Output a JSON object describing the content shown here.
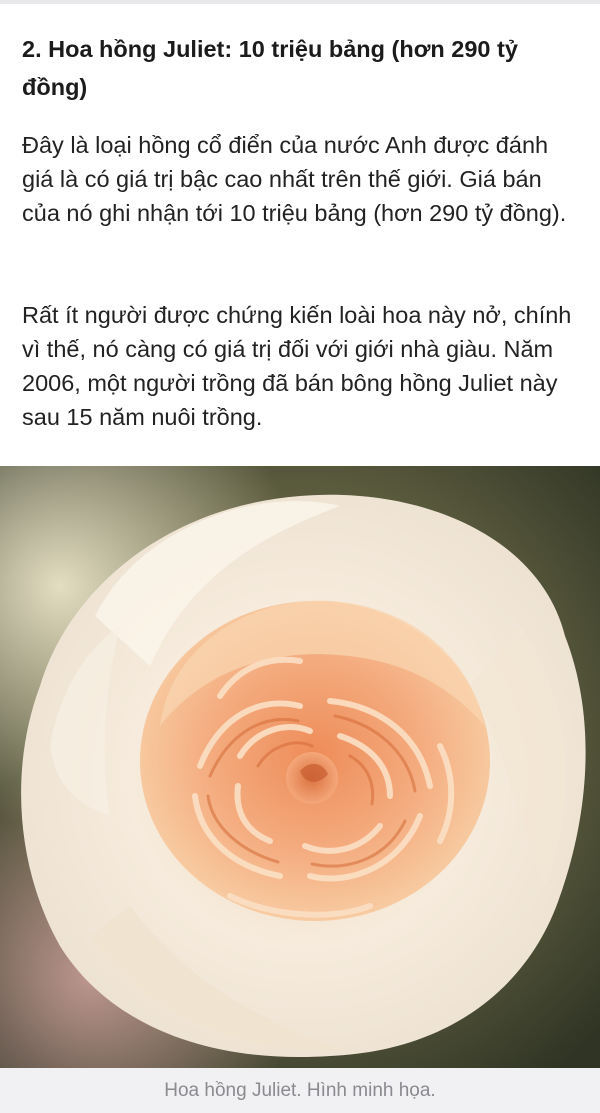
{
  "article": {
    "heading": "2. Hoa hồng Juliet: 10 triệu bảng (hơn 290 tỷ đồng)",
    "paragraphs": [
      "Đây là loại hồng cổ điển của nước Anh được đánh giá là có giá trị bậc cao nhất trên thế giới. Giá bán của nó ghi nhận tới 10 triệu bảng (hơn 290 tỷ đồng).",
      "Rất ít người được chứng kiến loài hoa này nở, chính vì thế, nó càng có giá trị đối với giới nhà giàu. Năm 2006, một người trồng đã bán bông hồng Juliet này sau 15 năm nuôi trồng."
    ]
  },
  "figure": {
    "caption": "Hoa hồng Juliet. Hình minh họa."
  },
  "colors": {
    "petal_outer": "#f6ecdc",
    "petal_center": "#f29a6a",
    "caption_bg": "#f1f1f3",
    "caption_text": "#8a8a8f"
  }
}
